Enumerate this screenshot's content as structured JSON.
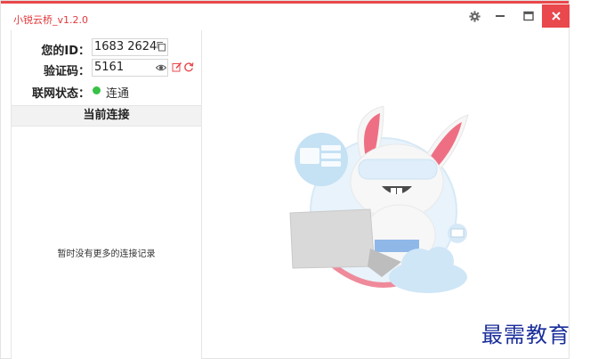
{
  "window": {
    "title": "小锐云桥_v1.2.0",
    "accent_color": "#e9484c"
  },
  "titlebar": {
    "icons": [
      "gear-icon",
      "minimize-icon",
      "maximize-icon",
      "close-icon"
    ]
  },
  "info": {
    "id_label": "您的ID：",
    "id_value": "1683 2624",
    "code_label": "验证码：",
    "code_value": "5161",
    "status_label": "联网状态：",
    "status_value": "连通",
    "status_color": "#37c245"
  },
  "connections": {
    "header": "当前连接",
    "empty_text": "暂时没有更多的连接记录"
  },
  "watermark": "最需教育"
}
